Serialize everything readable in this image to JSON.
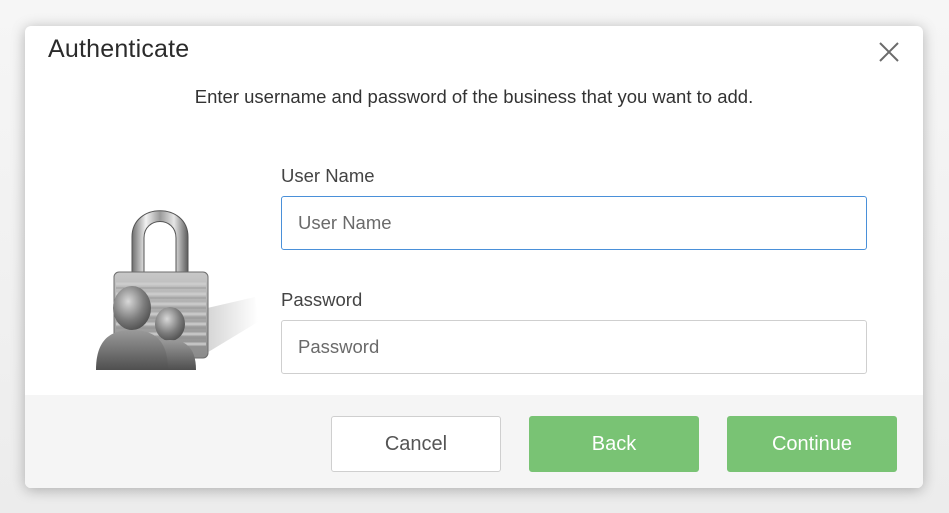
{
  "dialog": {
    "title": "Authenticate",
    "subtitle": "Enter username and password of the business that you want to add.",
    "close_icon": "close-icon",
    "illustration_icon": "padlock-users-icon"
  },
  "form": {
    "username": {
      "label": "User Name",
      "placeholder": "User Name",
      "value": ""
    },
    "password": {
      "label": "Password",
      "placeholder": "Password",
      "value": ""
    }
  },
  "footer": {
    "cancel_label": "Cancel",
    "back_label": "Back",
    "continue_label": "Continue"
  },
  "colors": {
    "primary_green": "#79c374",
    "focus_blue": "#4a90d9",
    "footer_bg": "#f5f5f5"
  }
}
